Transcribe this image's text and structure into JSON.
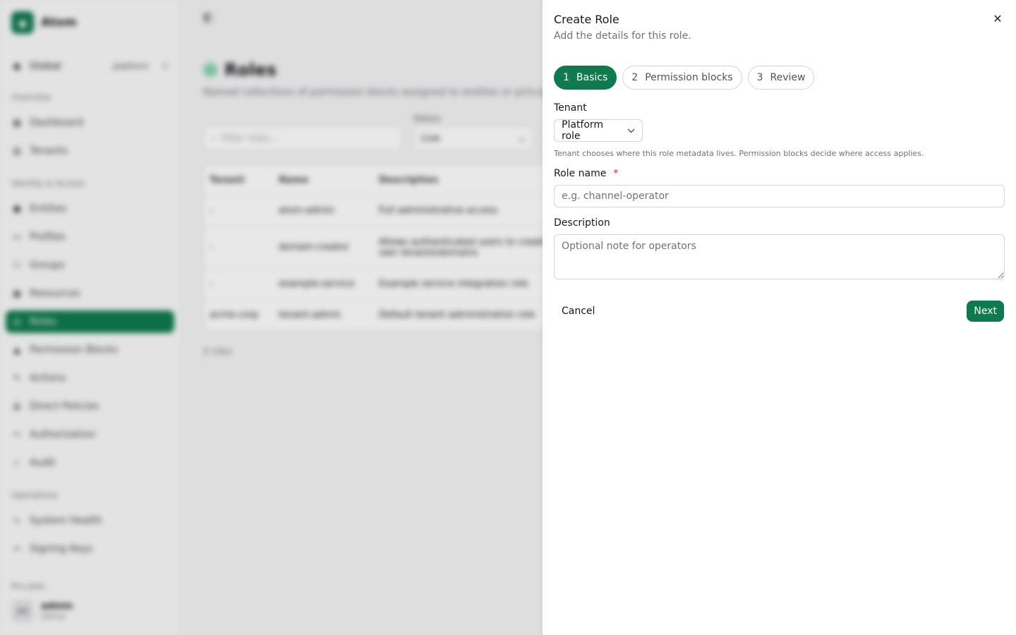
{
  "sidebar": {
    "brand": "Atom",
    "scope_label": "Global",
    "scope_value": "platform",
    "groups": [
      {
        "label": "Overview",
        "items": [
          {
            "label": "Dashboard"
          },
          {
            "label": "Tenants"
          }
        ]
      },
      {
        "label": "Identity & Access",
        "items": [
          {
            "label": "Entities"
          },
          {
            "label": "Profiles"
          },
          {
            "label": "Groups"
          },
          {
            "label": "Resources"
          },
          {
            "label": "Roles"
          },
          {
            "label": "Permission Blocks"
          },
          {
            "label": "Actions"
          },
          {
            "label": "Direct Policies"
          },
          {
            "label": "Authorization"
          },
          {
            "label": "Audit"
          }
        ]
      },
      {
        "label": "Operations",
        "items": [
          {
            "label": "System Health"
          },
          {
            "label": "Signing Keys"
          }
        ]
      }
    ],
    "user_section_label": "Pro plan",
    "user": {
      "initials": "AD",
      "name": "admin",
      "role": "Owner"
    }
  },
  "page": {
    "title": "Roles",
    "description": "Named collections of permission blocks assigned to entities or principal groups.",
    "filter_placeholder": "Filter roles...",
    "status_label": "Status",
    "status_value": "Live",
    "columns": [
      "Tenant",
      "Name",
      "Description"
    ],
    "rows": [
      {
        "tenant": "-",
        "name": "atom-admin",
        "description": "Full administrative access"
      },
      {
        "tenant": "-",
        "name": "domain-creator",
        "description": "Allows authenticated users to create their own tenants/domains"
      },
      {
        "tenant": "-",
        "name": "example-service",
        "description": "Example service integration role"
      },
      {
        "tenant": "acme-corp",
        "name": "tenant-admin",
        "description": "Default tenant administration role"
      }
    ],
    "count": "4 roles"
  },
  "drawer": {
    "title": "Create Role",
    "subtitle": "Add the details for this role.",
    "close_glyph": "✕",
    "steps": [
      {
        "num": "1",
        "label": "Basics",
        "active": true
      },
      {
        "num": "2",
        "label": "Permission blocks",
        "active": false
      },
      {
        "num": "3",
        "label": "Review",
        "active": false
      }
    ],
    "tenant_label": "Tenant",
    "tenant_value": "Platform role",
    "tenant_hint": "Tenant chooses where this role metadata lives. Permission blocks decide where access applies.",
    "name_label": "Role name",
    "required_mark": "*",
    "name_placeholder": "e.g. channel-operator",
    "description_label": "Description",
    "description_placeholder": "Optional note for operators",
    "cancel_label": "Cancel",
    "next_label": "Next"
  },
  "colors": {
    "accent": "#0f7a4e",
    "required": "#dc2626"
  },
  "icons": {
    "close": "close-icon",
    "chevron": "chevron-down-icon"
  }
}
